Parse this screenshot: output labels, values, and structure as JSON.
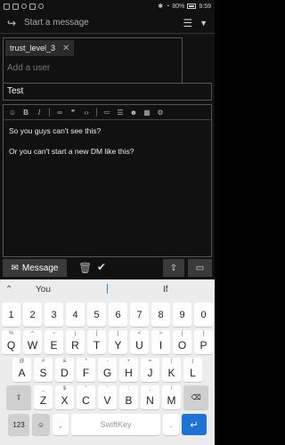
{
  "status_bar": {
    "battery": "80%",
    "time": "9:59"
  },
  "header": {
    "title": "Start a message"
  },
  "recipients": {
    "chip": "trust_level_3",
    "add_placeholder": "Add a user"
  },
  "title_field": {
    "value": "Test"
  },
  "editor": {
    "toolbar": [
      "emoji",
      "bold",
      "italic",
      "link",
      "quote",
      "code",
      "bullet-list",
      "numbered-list",
      "emoji-smile",
      "calendar",
      "gear"
    ],
    "lines": [
      "So you guys can't see this?",
      "Or you can't start a new DM like this?"
    ]
  },
  "footer": {
    "send_label": "Message"
  },
  "keyboard": {
    "suggestions": [
      "You",
      "I",
      "If"
    ],
    "row_numbers": [
      "1",
      "2",
      "3",
      "4",
      "5",
      "6",
      "7",
      "8",
      "9",
      "0"
    ],
    "row1": [
      [
        "Q",
        "%"
      ],
      [
        "W",
        "^"
      ],
      [
        "E",
        "~"
      ],
      [
        "R",
        "|"
      ],
      [
        "T",
        "["
      ],
      [
        "Y",
        "]"
      ],
      [
        "U",
        "<"
      ],
      [
        "I",
        ">"
      ],
      [
        "O",
        "{"
      ],
      [
        "P",
        "}"
      ]
    ],
    "row2": [
      [
        "A",
        "@"
      ],
      [
        "S",
        "#"
      ],
      [
        "D",
        "&"
      ],
      [
        "F",
        "*"
      ],
      [
        "G",
        "-"
      ],
      [
        "H",
        "+"
      ],
      [
        "J",
        "="
      ],
      [
        "K",
        "("
      ],
      [
        "L",
        ")"
      ]
    ],
    "row3": [
      [
        "Z",
        "_"
      ],
      [
        "X",
        "$"
      ],
      [
        "C",
        "\""
      ],
      [
        "V",
        "'"
      ],
      [
        "B",
        ":"
      ],
      [
        "N",
        ";"
      ],
      [
        "M",
        "/"
      ]
    ],
    "fn_key": "123",
    "comma": ",",
    "space_label": "SwiftKey",
    "period": "."
  }
}
